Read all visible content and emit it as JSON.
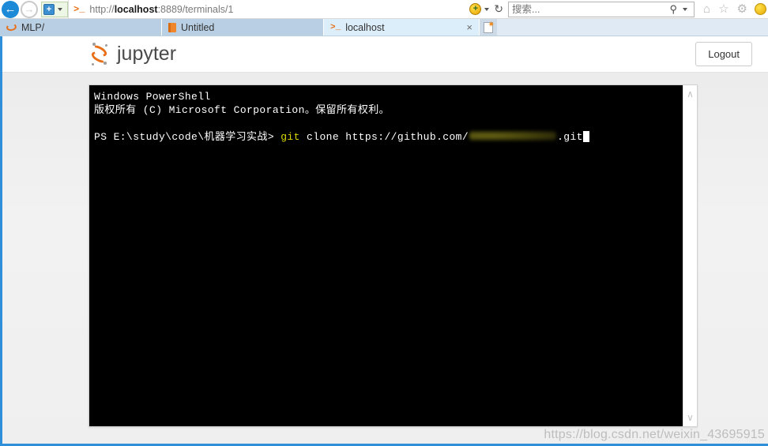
{
  "browser": {
    "back_icon": "back-arrow-icon",
    "forward_icon": "forward-arrow-icon",
    "site_shield_glyph": "+",
    "url_icon": ">_",
    "url_prefix": "http://",
    "url_host": "localhost",
    "url_suffix": ":8889/terminals/1",
    "url_full": "http://localhost:8889/terminals/1",
    "add_icon_glyph": "+",
    "refresh_glyph": "↻",
    "search": {
      "placeholder": "搜索...",
      "value": "",
      "magnifier_glyph": "⚲"
    },
    "icons": {
      "home": "⌂",
      "favorites": "☆",
      "settings": "⚙",
      "notify": "●"
    },
    "tabs": [
      {
        "label": "MLP/",
        "icon": "jupyter-arc-icon",
        "active": false
      },
      {
        "label": "Untitled",
        "icon": "notebook-icon",
        "active": false
      },
      {
        "label": "localhost",
        "icon": "terminal-prompt-icon",
        "active": true
      }
    ],
    "tab_close_glyph": "×",
    "new_tab_star": "✷"
  },
  "jupyter": {
    "wordmark": "jupyter",
    "logout_label": "Logout"
  },
  "terminal": {
    "line1": "Windows PowerShell",
    "line2": "版权所有 (C) Microsoft Corporation。保留所有权利。",
    "prompt": "PS E:\\study\\code\\机器学习实战> ",
    "command_keyword": "git",
    "command_rest": " clone https://github.com/",
    "redacted_label": "redacted-repo-path",
    "command_tail": ".git",
    "scroll_up_glyph": "∧",
    "scroll_down_glyph": "∨"
  },
  "watermark": {
    "text": "https://blog.csdn.net/weixin_43695915"
  },
  "colors": {
    "accent_blue": "#2f8fd8",
    "jupyter_orange": "#e8701a",
    "terminal_bg": "#000000",
    "terminal_fg": "#ffffff",
    "terminal_keyword": "#d8d800"
  }
}
